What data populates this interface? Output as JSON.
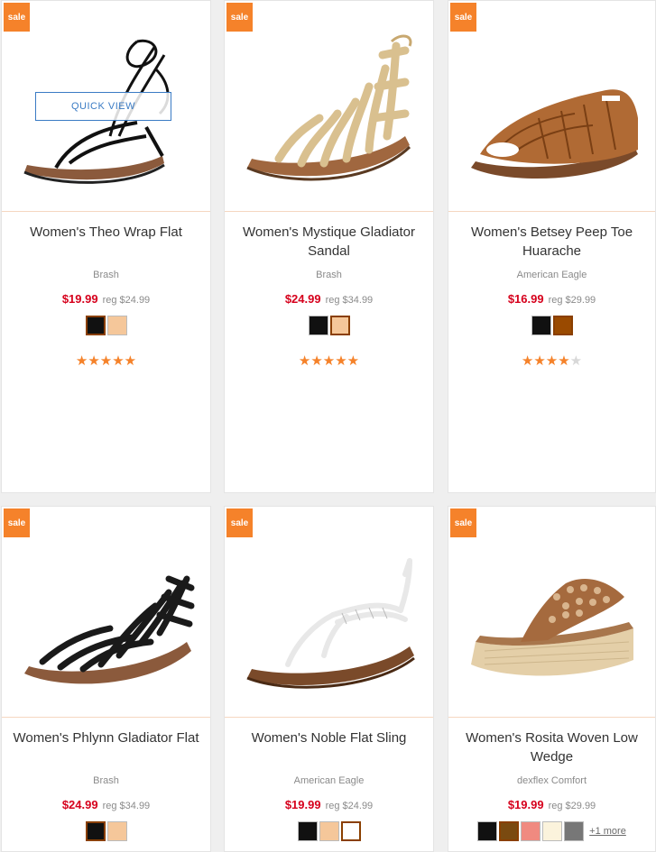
{
  "products": [
    {
      "badge": "sale",
      "title": "Women's Theo Wrap Flat",
      "brand": "Brash",
      "sale_price": "$19.99",
      "reg_price": "reg $24.99",
      "swatches": [
        "#111111",
        "#f5c79a"
      ],
      "selected_swatch": 0,
      "rating": 5,
      "quick_view": "QUICK VIEW"
    },
    {
      "badge": "sale",
      "title": "Women's Mystique Gladiator Sandal",
      "brand": "Brash",
      "sale_price": "$24.99",
      "reg_price": "reg $34.99",
      "swatches": [
        "#111111",
        "#f5c79a"
      ],
      "selected_swatch": 1,
      "rating": 5
    },
    {
      "badge": "sale",
      "title": "Women's Betsey Peep Toe Huarache",
      "brand": "American Eagle",
      "sale_price": "$16.99",
      "reg_price": "reg $29.99",
      "swatches": [
        "#111111",
        "#9a4a00"
      ],
      "selected_swatch": 1,
      "rating": 4
    },
    {
      "badge": "sale",
      "title": "Women's Phlynn Gladiator Flat",
      "brand": "Brash",
      "sale_price": "$24.99",
      "reg_price": "reg $34.99",
      "swatches": [
        "#111111",
        "#f5c79a"
      ],
      "selected_swatch": 0
    },
    {
      "badge": "sale",
      "title": "Women's Noble Flat Sling",
      "brand": "American Eagle",
      "sale_price": "$19.99",
      "reg_price": "reg $24.99",
      "swatches": [
        "#111111",
        "#f5c79a",
        "#ffffff"
      ],
      "selected_swatch": 2
    },
    {
      "badge": "sale",
      "title": "Women's Rosita Woven Low Wedge",
      "brand": "dexflex Comfort",
      "sale_price": "$19.99",
      "reg_price": "reg $29.99",
      "swatches": [
        "#111111",
        "#7a4a10",
        "#f08a80",
        "#fbf3dc",
        "#777777"
      ],
      "selected_swatch": 1,
      "more_link": "+1 more"
    }
  ],
  "colors": {
    "accent": "#f5822a",
    "sale_price": "#d6001c",
    "link": "#3a7bc4"
  }
}
